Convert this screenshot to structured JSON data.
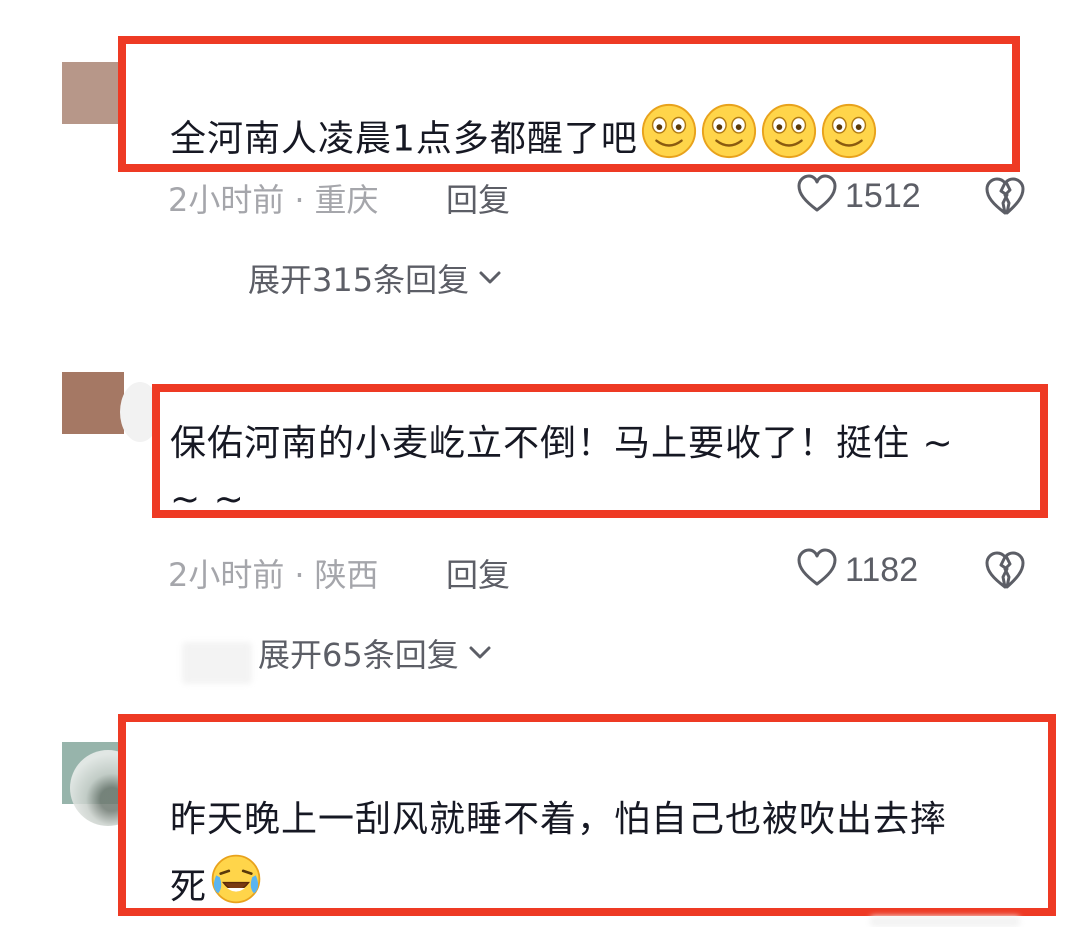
{
  "comments": [
    {
      "text": "全河南人凌晨1点多都醒了吧",
      "time": "2小时前",
      "separator": "·",
      "location": "重庆",
      "reply_label": "回复",
      "likes": "1512",
      "expand_label": "展开315条回复",
      "emojis": [
        "smile-face",
        "smile-face",
        "smile-face",
        "smile-face"
      ],
      "avatar_color": "#b79789"
    },
    {
      "text_line1": "保佑河南的小麦屹立不倒！马上要收了！挺住 ~",
      "text_line2": "~ ~",
      "time": "2小时前",
      "separator": "·",
      "location": "陕西",
      "reply_label": "回复",
      "likes": "1182",
      "expand_label": "展开65条回复",
      "avatar_color": "#a57864"
    },
    {
      "text_line1": "昨天晚上一刮风就睡不着，怕自己也被吹出去摔",
      "text_line2": "死",
      "emojis": [
        "laugh-cry-face"
      ],
      "avatar_color": "#97b4ab"
    }
  ],
  "colors": {
    "highlight": "#ee3a24",
    "meta_text": "#a5a6ab",
    "action_text": "#5c5e66",
    "body_text": "#161823"
  }
}
